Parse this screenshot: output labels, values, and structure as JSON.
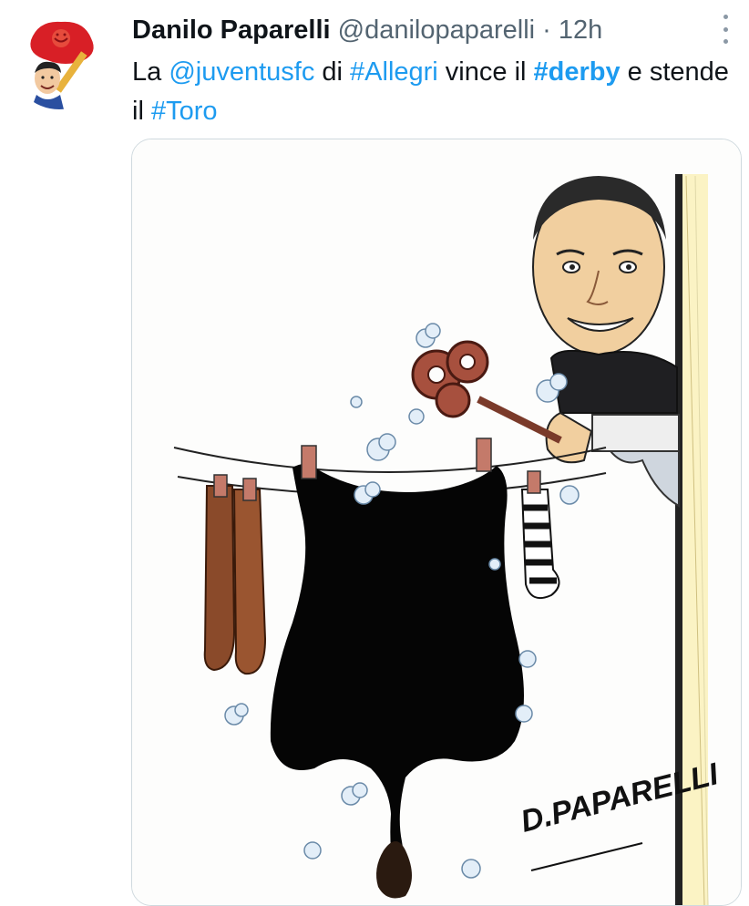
{
  "tweet": {
    "author_name": "Danilo Paparelli",
    "handle": "@danilopaparelli",
    "separator": "·",
    "time": "12h",
    "text_1": "La ",
    "mention": "@juventusfc",
    "text_2": " di ",
    "hashtag_1": "#Allegri",
    "text_3": " vince il ",
    "hashtag_2": "#derby",
    "text_4": " e stende il ",
    "hashtag_3": "#Toro"
  },
  "cartoon": {
    "signature": "D.PAPARELLI"
  },
  "colors": {
    "link": "#1d9bf0",
    "text": "#0f1419",
    "secondary": "#536471",
    "border": "#cfd9de"
  },
  "icons": {
    "more": "more-dots-icon"
  }
}
